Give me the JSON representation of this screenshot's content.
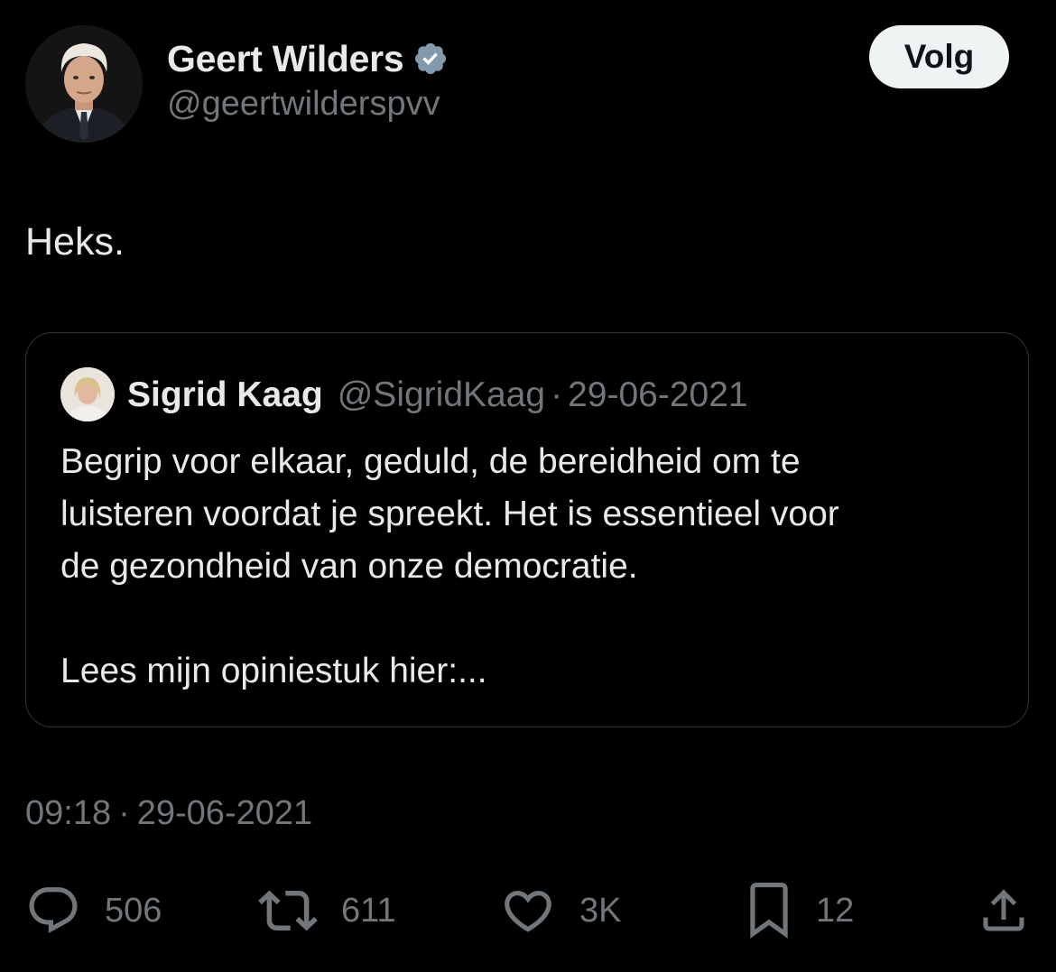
{
  "author": {
    "name": "Geert Wilders",
    "handle": "@geertwilderspvv",
    "verified": true
  },
  "follow_button": {
    "label": "Volg"
  },
  "tweet": {
    "text": "Heks.",
    "time": "09:18",
    "separator": "·",
    "date": "29-06-2021"
  },
  "quoted_tweet": {
    "name": "Sigrid Kaag",
    "handle": "@SigridKaag",
    "separator": "·",
    "date": "29-06-2021",
    "text_line_1": "Begrip voor elkaar, geduld, de bereidheid om te",
    "text_line_2": "luisteren voordat je spreekt. Het is essentieel voor",
    "text_line_3": "de gezondheid van onze democratie.",
    "text_line_4": "Lees mijn opiniestuk hier:..."
  },
  "actions": {
    "replies": "506",
    "retweets": "611",
    "likes": "3K",
    "bookmarks": "12"
  },
  "icons": {
    "reply": "speech-bubble-icon",
    "retweet": "retweet-arrows-icon",
    "like": "heart-icon",
    "bookmark": "bookmark-icon",
    "share": "share-upload-icon",
    "verified": "verified-badge-icon"
  },
  "colors": {
    "background": "#000000",
    "primary_text": "#e7e9ea",
    "secondary_text": "#71767b",
    "border": "#2f3336",
    "verified_badge": "#829aab",
    "follow_button_bg": "#eff3f4"
  }
}
